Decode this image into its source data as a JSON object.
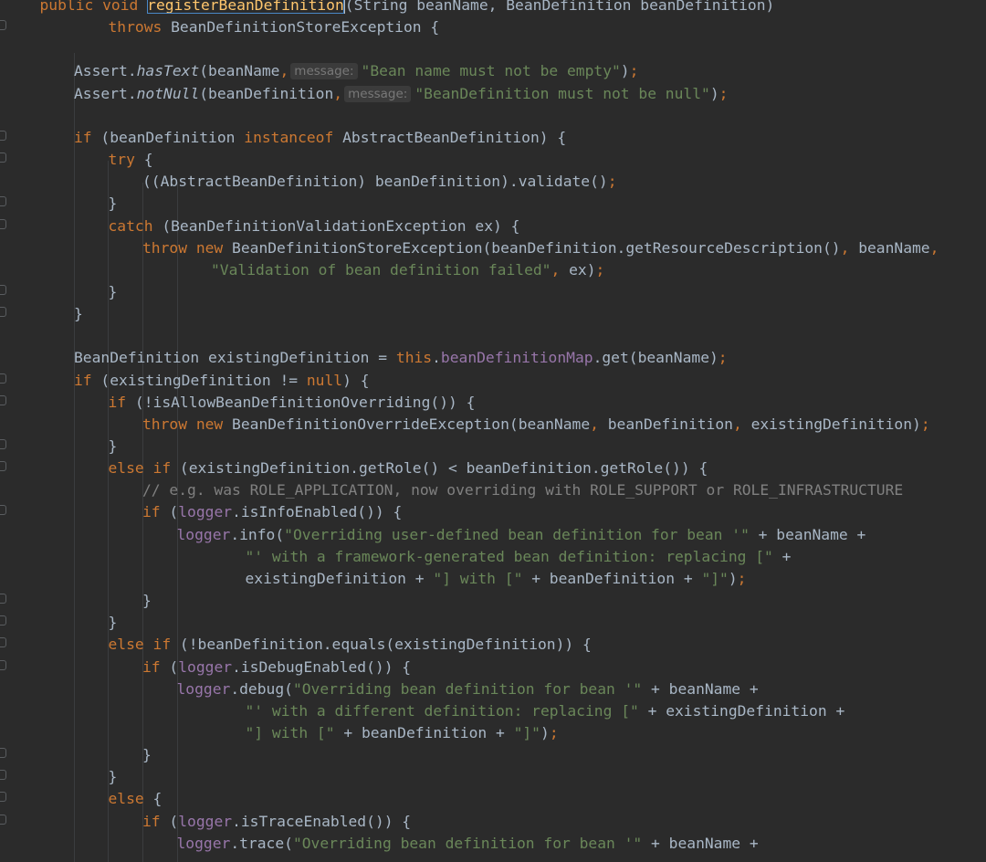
{
  "editor": {
    "language": "java",
    "method_name": "registerBeanDefinition",
    "colors": {
      "background": "#2b2b2b",
      "text": "#a9b7c6",
      "keyword": "#cc7832",
      "string": "#6a8759",
      "field": "#9876aa",
      "comment": "#808080",
      "method_declaration": "#ffc66d",
      "selection_outline": "#4a88c7",
      "param_hint": "#787878"
    },
    "lines": [
      {
        "indent": 1,
        "tokens": [
          {
            "t": "public void ",
            "c": "kw"
          },
          {
            "t": "registerBeanDefinition",
            "c": "hl"
          },
          {
            "t": "(",
            "c": "cursor"
          },
          {
            "t": "String beanName, BeanDefinition beanDefinition)"
          }
        ]
      },
      {
        "indent": 3,
        "tokens": [
          {
            "t": "throws ",
            "c": "kw"
          },
          {
            "t": "BeanDefinitionStoreException {"
          }
        ]
      },
      {
        "indent": 0,
        "tokens": []
      },
      {
        "indent": 2,
        "tokens": [
          {
            "t": "Assert."
          },
          {
            "t": "hasText",
            "c": "it"
          },
          {
            "t": "(beanName"
          },
          {
            "t": ",",
            "c": "kw"
          },
          {
            "t": "message:",
            "c": "hint"
          },
          {
            "t": "\"Bean name must not be empty\"",
            "c": "str"
          },
          {
            "t": ")"
          },
          {
            "t": ";",
            "c": "kw"
          }
        ]
      },
      {
        "indent": 2,
        "tokens": [
          {
            "t": "Assert."
          },
          {
            "t": "notNull",
            "c": "it"
          },
          {
            "t": "(beanDefinition"
          },
          {
            "t": ",",
            "c": "kw"
          },
          {
            "t": "message:",
            "c": "hint"
          },
          {
            "t": "\"BeanDefinition must not be null\"",
            "c": "str"
          },
          {
            "t": ")"
          },
          {
            "t": ";",
            "c": "kw"
          }
        ]
      },
      {
        "indent": 0,
        "tokens": []
      },
      {
        "indent": 2,
        "tokens": [
          {
            "t": "if ",
            "c": "kw"
          },
          {
            "t": "(beanDefinition "
          },
          {
            "t": "instanceof ",
            "c": "kw"
          },
          {
            "t": "AbstractBeanDefinition) {"
          }
        ]
      },
      {
        "indent": 3,
        "tokens": [
          {
            "t": "try ",
            "c": "kw"
          },
          {
            "t": "{"
          }
        ]
      },
      {
        "indent": 4,
        "tokens": [
          {
            "t": "((AbstractBeanDefinition) beanDefinition).validate()"
          },
          {
            "t": ";",
            "c": "kw"
          }
        ]
      },
      {
        "indent": 3,
        "tokens": [
          {
            "t": "}"
          }
        ]
      },
      {
        "indent": 3,
        "tokens": [
          {
            "t": "catch ",
            "c": "kw"
          },
          {
            "t": "(BeanDefinitionValidationException ex) {"
          }
        ]
      },
      {
        "indent": 4,
        "tokens": [
          {
            "t": "throw new ",
            "c": "kw"
          },
          {
            "t": "BeanDefinitionStoreException(beanDefinition.getResourceDescription()"
          },
          {
            "t": ", ",
            "c": "kw"
          },
          {
            "t": "beanName"
          },
          {
            "t": ",",
            "c": "kw"
          }
        ]
      },
      {
        "indent": 6,
        "tokens": [
          {
            "t": "\"Validation of bean definition failed\"",
            "c": "str"
          },
          {
            "t": ", ",
            "c": "kw"
          },
          {
            "t": "ex)"
          },
          {
            "t": ";",
            "c": "kw"
          }
        ]
      },
      {
        "indent": 3,
        "tokens": [
          {
            "t": "}"
          }
        ]
      },
      {
        "indent": 2,
        "tokens": [
          {
            "t": "}"
          }
        ]
      },
      {
        "indent": 0,
        "tokens": []
      },
      {
        "indent": 2,
        "tokens": [
          {
            "t": "BeanDefinition existingDefinition = "
          },
          {
            "t": "this",
            "c": "kw"
          },
          {
            "t": "."
          },
          {
            "t": "beanDefinitionMap",
            "c": "fld"
          },
          {
            "t": ".get(beanName)"
          },
          {
            "t": ";",
            "c": "kw"
          }
        ]
      },
      {
        "indent": 2,
        "tokens": [
          {
            "t": "if ",
            "c": "kw"
          },
          {
            "t": "(existingDefinition != "
          },
          {
            "t": "null",
            "c": "kw"
          },
          {
            "t": ") {"
          }
        ]
      },
      {
        "indent": 3,
        "tokens": [
          {
            "t": "if ",
            "c": "kw"
          },
          {
            "t": "(!isAllowBeanDefinitionOverriding()) {"
          }
        ]
      },
      {
        "indent": 4,
        "tokens": [
          {
            "t": "throw new ",
            "c": "kw"
          },
          {
            "t": "BeanDefinitionOverrideException(beanName"
          },
          {
            "t": ", ",
            "c": "kw"
          },
          {
            "t": "beanDefinition"
          },
          {
            "t": ", ",
            "c": "kw"
          },
          {
            "t": "existingDefinition)"
          },
          {
            "t": ";",
            "c": "kw"
          }
        ]
      },
      {
        "indent": 3,
        "tokens": [
          {
            "t": "}"
          }
        ]
      },
      {
        "indent": 3,
        "tokens": [
          {
            "t": "else if ",
            "c": "kw"
          },
          {
            "t": "(existingDefinition.getRole() < beanDefinition.getRole()) {"
          }
        ]
      },
      {
        "indent": 4,
        "tokens": [
          {
            "t": "// e.g. was ROLE_APPLICATION, now overriding with ROLE_SUPPORT or ROLE_INFRASTRUCTURE",
            "c": "cm"
          }
        ]
      },
      {
        "indent": 4,
        "tokens": [
          {
            "t": "if ",
            "c": "kw"
          },
          {
            "t": "("
          },
          {
            "t": "logger",
            "c": "fld"
          },
          {
            "t": ".isInfoEnabled()) {"
          }
        ]
      },
      {
        "indent": 5,
        "tokens": [
          {
            "t": "logger",
            "c": "fld"
          },
          {
            "t": ".info("
          },
          {
            "t": "\"Overriding user-defined bean definition for bean '\"",
            "c": "str"
          },
          {
            "t": " + beanName +"
          }
        ]
      },
      {
        "indent": 7,
        "tokens": [
          {
            "t": "\"' with a framework-generated bean definition: replacing [\"",
            "c": "str"
          },
          {
            "t": " +"
          }
        ]
      },
      {
        "indent": 7,
        "tokens": [
          {
            "t": "existingDefinition + "
          },
          {
            "t": "\"] with [\"",
            "c": "str"
          },
          {
            "t": " + beanDefinition + "
          },
          {
            "t": "\"]\"",
            "c": "str"
          },
          {
            "t": ")"
          },
          {
            "t": ";",
            "c": "kw"
          }
        ]
      },
      {
        "indent": 4,
        "tokens": [
          {
            "t": "}"
          }
        ]
      },
      {
        "indent": 3,
        "tokens": [
          {
            "t": "}"
          }
        ]
      },
      {
        "indent": 3,
        "tokens": [
          {
            "t": "else if ",
            "c": "kw"
          },
          {
            "t": "(!beanDefinition.equals(existingDefinition)) {"
          }
        ]
      },
      {
        "indent": 4,
        "tokens": [
          {
            "t": "if ",
            "c": "kw"
          },
          {
            "t": "("
          },
          {
            "t": "logger",
            "c": "fld"
          },
          {
            "t": ".isDebugEnabled()) {"
          }
        ]
      },
      {
        "indent": 5,
        "tokens": [
          {
            "t": "logger",
            "c": "fld"
          },
          {
            "t": ".debug("
          },
          {
            "t": "\"Overriding bean definition for bean '\"",
            "c": "str"
          },
          {
            "t": " + beanName +"
          }
        ]
      },
      {
        "indent": 7,
        "tokens": [
          {
            "t": "\"' with a different definition: replacing [\"",
            "c": "str"
          },
          {
            "t": " + existingDefinition +"
          }
        ]
      },
      {
        "indent": 7,
        "tokens": [
          {
            "t": "\"] with [\"",
            "c": "str"
          },
          {
            "t": " + beanDefinition + "
          },
          {
            "t": "\"]\"",
            "c": "str"
          },
          {
            "t": ")"
          },
          {
            "t": ";",
            "c": "kw"
          }
        ]
      },
      {
        "indent": 4,
        "tokens": [
          {
            "t": "}"
          }
        ]
      },
      {
        "indent": 3,
        "tokens": [
          {
            "t": "}"
          }
        ]
      },
      {
        "indent": 3,
        "tokens": [
          {
            "t": "else ",
            "c": "kw"
          },
          {
            "t": "{"
          }
        ]
      },
      {
        "indent": 4,
        "tokens": [
          {
            "t": "if ",
            "c": "kw"
          },
          {
            "t": "("
          },
          {
            "t": "logger",
            "c": "fld"
          },
          {
            "t": ".isTraceEnabled()) {"
          }
        ]
      },
      {
        "indent": 5,
        "tokens": [
          {
            "t": "logger",
            "c": "fld"
          },
          {
            "t": ".trace("
          },
          {
            "t": "\"Overriding bean definition for bean '\"",
            "c": "str"
          },
          {
            "t": " + beanName +"
          }
        ]
      }
    ]
  }
}
